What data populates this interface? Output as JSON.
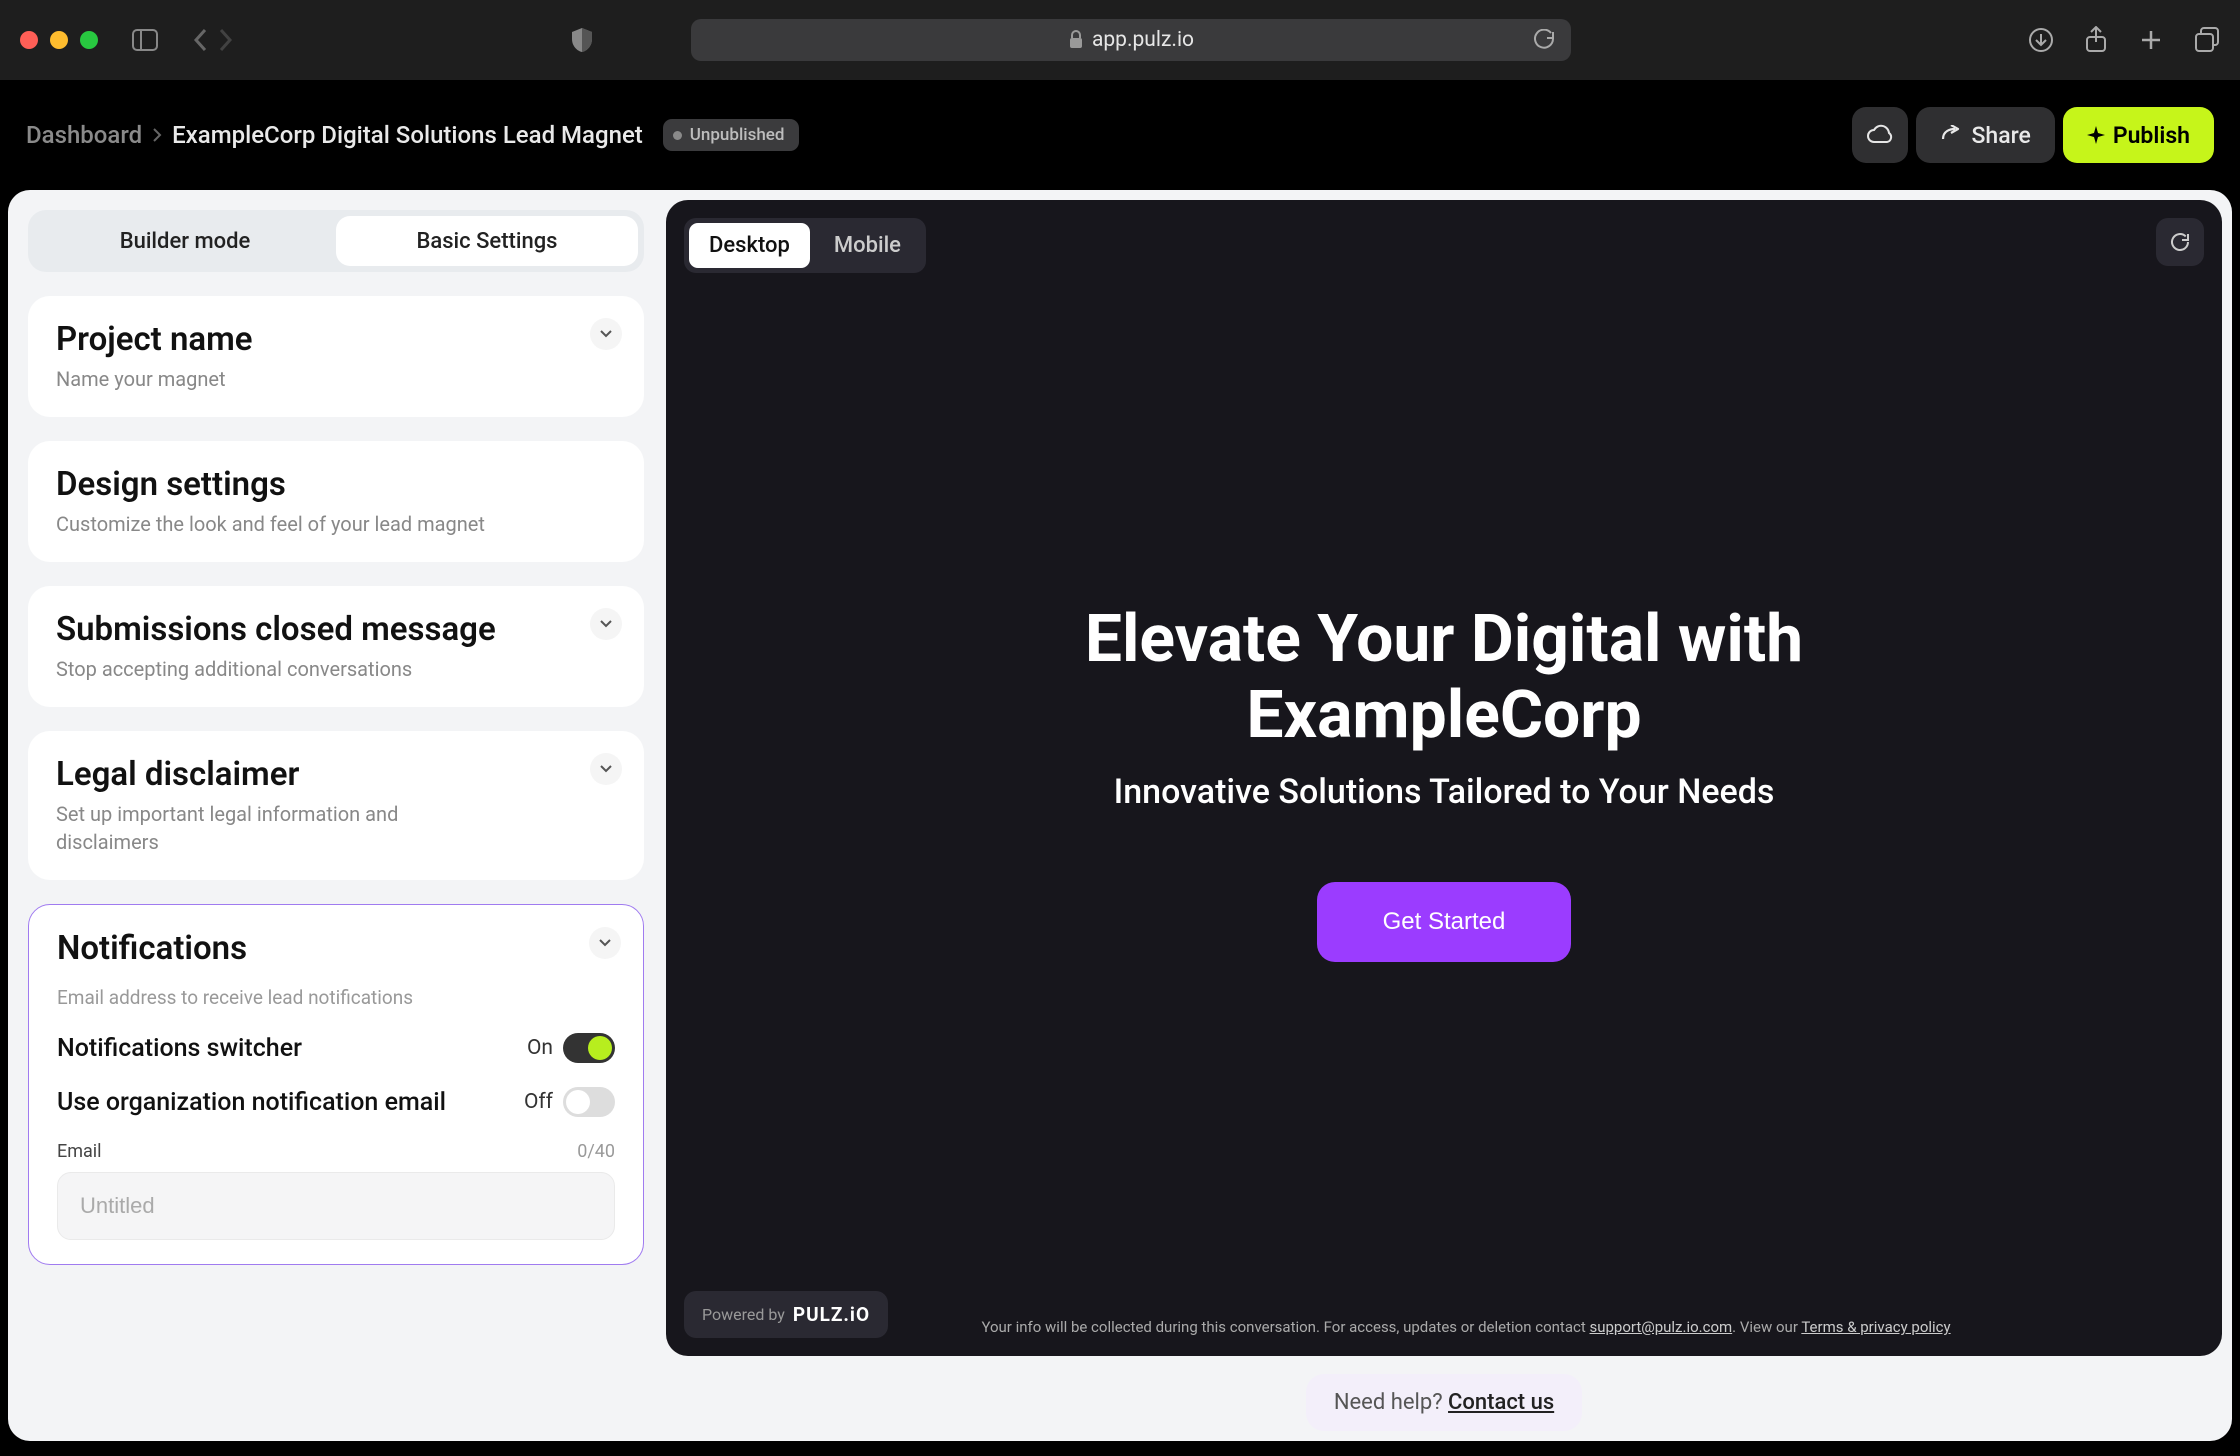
{
  "browser": {
    "url_host": "app.pulz.io"
  },
  "header": {
    "breadcrumb_dashboard": "Dashboard",
    "breadcrumb_project": "ExampleCorp Digital Solutions Lead Magnet",
    "status_label": "Unpublished",
    "share_label": "Share",
    "publish_label": "Publish"
  },
  "sidebar": {
    "mode_builder": "Builder mode",
    "mode_basic": "Basic Settings",
    "cards": {
      "project_name": {
        "title": "Project name",
        "subtitle": "Name your magnet"
      },
      "design": {
        "title": "Design settings",
        "subtitle": "Customize the look and feel of your lead magnet"
      },
      "submissions": {
        "title": "Submissions closed message",
        "subtitle": "Stop accepting additional conversations"
      },
      "legal": {
        "title": "Legal disclaimer",
        "subtitle": "Set up important legal information and disclaimers"
      },
      "notifications": {
        "title": "Notifications",
        "desc": "Email address to receive lead notifications",
        "switcher_label": "Notifications switcher",
        "switcher_state": "On",
        "org_email_label": "Use organization notification email",
        "org_email_state": "Off",
        "email_label": "Email",
        "email_counter": "0/40",
        "email_placeholder": "Untitled"
      }
    }
  },
  "preview": {
    "device_desktop": "Desktop",
    "device_mobile": "Mobile",
    "hero_title": "Elevate Your Digital with ExampleCorp",
    "hero_subtitle": "Innovative Solutions Tailored to Your Needs",
    "cta_label": "Get Started",
    "powered_by_text": "Powered by",
    "powered_by_brand": "PULZ.iO",
    "disclaimer_line1": "Your info will be collected during this conversation. For access, updates or deletion contact ",
    "disclaimer_email": "support@pulz.io.com",
    "disclaimer_line2": ". View our ",
    "disclaimer_terms": "Terms & privacy policy"
  },
  "help": {
    "prompt": "Need help? ",
    "contact": "Contact us"
  }
}
